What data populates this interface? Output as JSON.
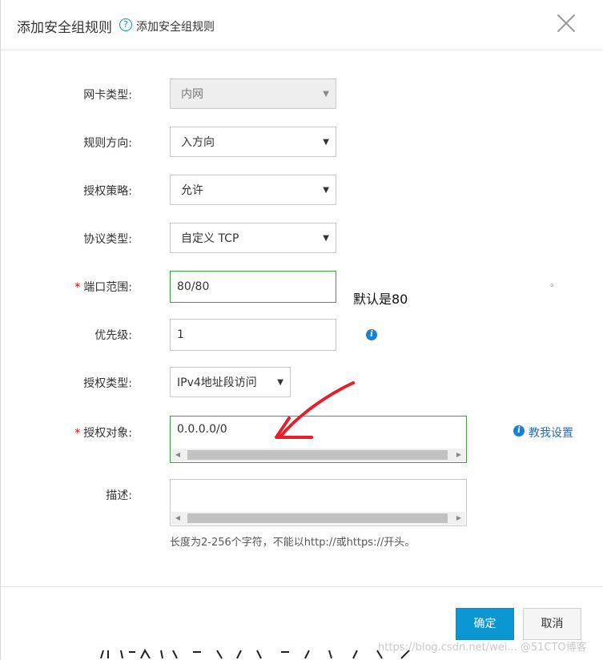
{
  "dialog": {
    "title": "添加安全组规则",
    "help_icon": "?",
    "subtitle": "添加安全组规则"
  },
  "form": {
    "nic_type": {
      "label": "网卡类型:",
      "value": "内网",
      "disabled": true
    },
    "direction": {
      "label": "规则方向:",
      "value": "入方向"
    },
    "policy": {
      "label": "授权策略:",
      "value": "允许"
    },
    "protocol": {
      "label": "协议类型:",
      "value": "自定义 TCP"
    },
    "port_range": {
      "label": "端口范围:",
      "required_mark": "*",
      "value": "80/80",
      "annotation": "默认是80",
      "stray_dot": "。"
    },
    "priority": {
      "label": "优先级:",
      "value": "1",
      "info_icon": "i"
    },
    "auth_type": {
      "label": "授权类型:",
      "value": "IPv4地址段访问"
    },
    "auth_object": {
      "label": "授权对象:",
      "required_mark": "*",
      "value": "0.0.0.0/0",
      "help_link": "教我设置",
      "info_icon": "i"
    },
    "description": {
      "label": "描述:",
      "value": "",
      "hint": "长度为2-256个字符，不能以http://或https://开头。"
    }
  },
  "footer": {
    "confirm_label": "确定",
    "cancel_label": "取消"
  },
  "watermark": "https://blog.csdn.net/wei... @51CTO博客",
  "colors": {
    "primary": "#0a96d0",
    "valid_border": "#3ca13c",
    "annotation_arrow": "#e3202b",
    "link": "#1d6fb8"
  }
}
